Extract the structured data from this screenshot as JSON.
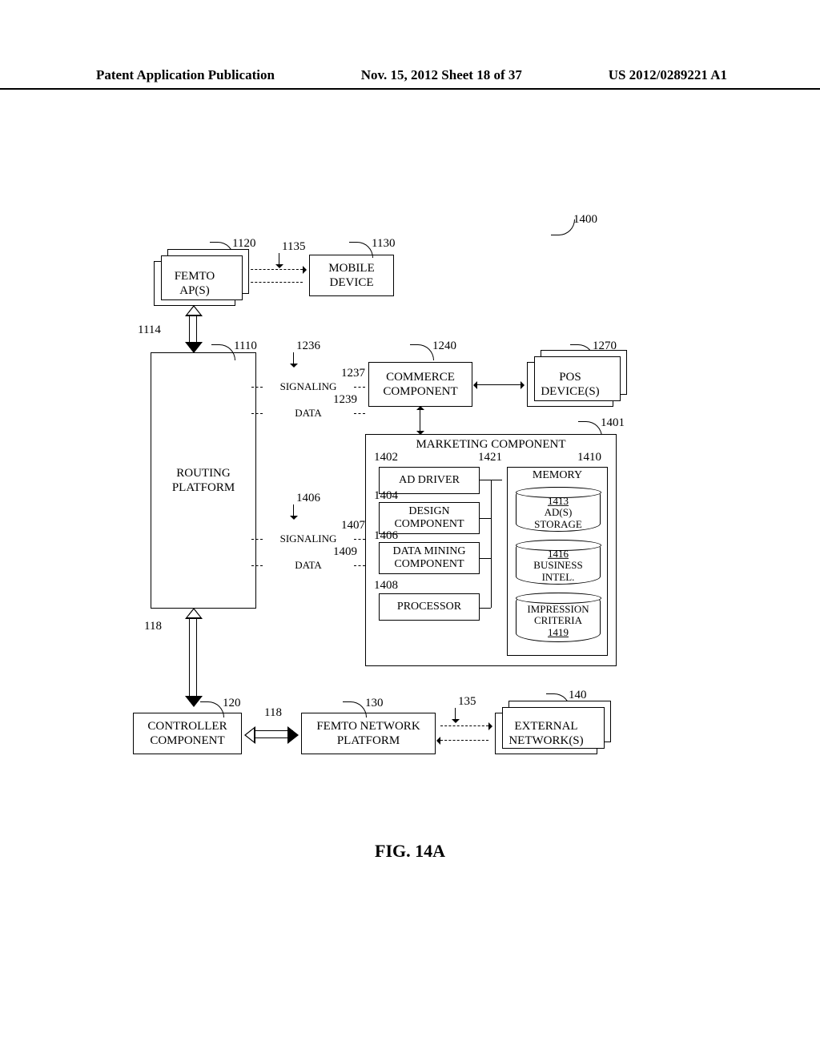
{
  "header": {
    "left": "Patent Application Publication",
    "center": "Nov. 15, 2012  Sheet 18 of 37",
    "right": "US 2012/0289221 A1"
  },
  "figure_caption": "FIG. 14A",
  "refs": {
    "r1400": "1400",
    "r1120": "1120",
    "r1135": "1135",
    "r1130": "1130",
    "r1114": "1114",
    "r1110": "1110",
    "r1236": "1236",
    "r1237": "1237",
    "r1239": "1239",
    "r1240": "1240",
    "r1270": "1270",
    "r1401": "1401",
    "r1402": "1402",
    "r1421": "1421",
    "r1410": "1410",
    "r1404": "1404",
    "r1406a": "1406",
    "r1406b": "1406",
    "r1407": "1407",
    "r1409": "1409",
    "r1408": "1408",
    "r1413": "1413",
    "r1416": "1416",
    "r1419": "1419",
    "r118a": "118",
    "r118b": "118",
    "r120": "120",
    "r130": "130",
    "r135": "135",
    "r140": "140"
  },
  "labels": {
    "femto_ap": "FEMTO\nAP(S)",
    "mobile_device": "MOBILE\nDEVICE",
    "routing_platform": "ROUTING\nPLATFORM",
    "commerce_component": "COMMERCE\nCOMPONENT",
    "pos_devices": "POS\nDEVICE(S)",
    "marketing_component": "MARKETING COMPONENT",
    "ad_driver": "AD DRIVER",
    "design_component": "DESIGN\nCOMPONENT",
    "data_mining_component": "DATA MINING\nCOMPONENT",
    "processor": "PROCESSOR",
    "memory": "MEMORY",
    "ads_storage": "AD(S)\nSTORAGE",
    "business_intel": "BUSINESS\nINTEL.",
    "impression_criteria": "IMPRESSION\nCRITERIA",
    "controller_component": "CONTROLLER\nCOMPONENT",
    "femto_network_platform": "FEMTO NETWORK\nPLATFORM",
    "external_networks": "EXTERNAL\nNETWORK(S)",
    "signaling": "SIGNALING",
    "data": "DATA"
  }
}
